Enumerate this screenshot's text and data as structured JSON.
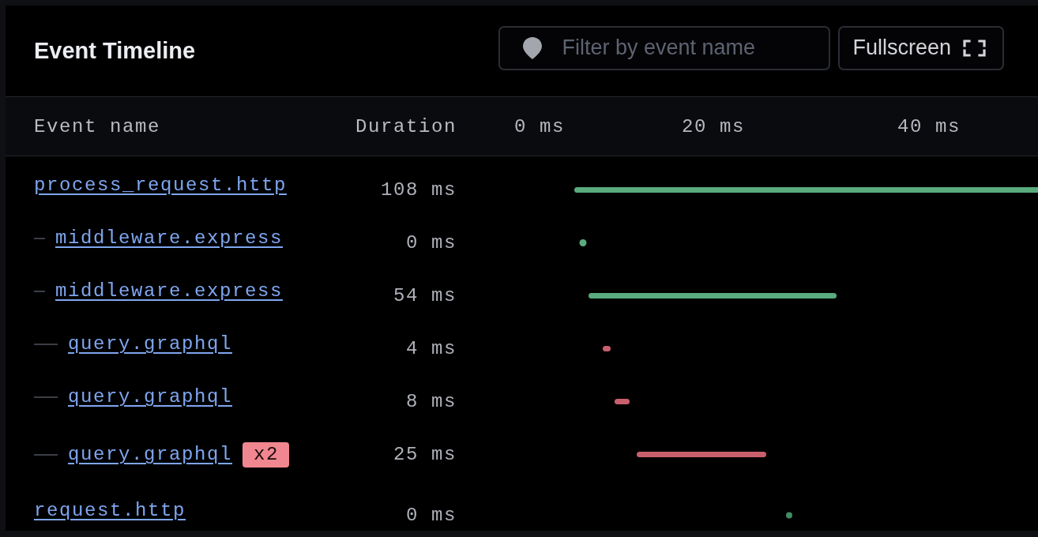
{
  "panel": {
    "title": "Event Timeline",
    "filter": {
      "placeholder": "Filter by event name"
    },
    "fullscreen_button": {
      "label": "Fullscreen"
    }
  },
  "table": {
    "columns": [
      "Event name",
      "Duration"
    ],
    "timeline_ticks": [
      "0 ms",
      "20 ms",
      "40 ms"
    ],
    "rows": [
      {
        "name": "process_request.http",
        "duration": "108 ms",
        "color": "#5aab7d",
        "children": [
          {
            "name": "middleware.express",
            "duration": "0 ms",
            "color": "#5aab7d"
          },
          {
            "name": "middleware.express",
            "duration": "54 ms",
            "color": "#5aab7d",
            "children": [
              {
                "name": "query.graphql",
                "duration": "4 ms",
                "color": "#c95f6d"
              },
              {
                "name": "query.graphql",
                "duration": "8 ms",
                "color": "#c95f6d"
              },
              {
                "name": "query.graphql",
                "badge": "x2",
                "duration": "25 ms",
                "color": "#c95f6d"
              }
            ]
          }
        ]
      },
      {
        "name": "request.http",
        "duration": "0 ms",
        "color": "#3f8c65"
      }
    ]
  }
}
